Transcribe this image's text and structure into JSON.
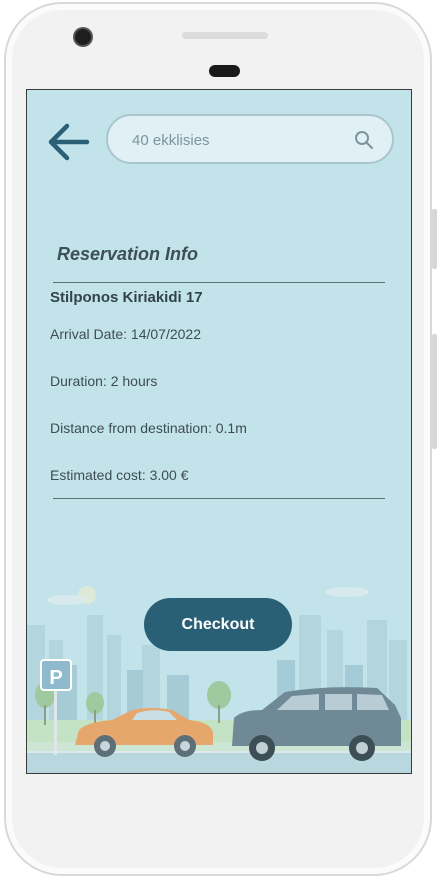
{
  "search": {
    "placeholder": "40 ekklisies",
    "value": ""
  },
  "reservation": {
    "heading": "Reservation Info",
    "address": "Stilponos Kiriakidi 17",
    "arrival": "Arrival Date: 14/07/2022",
    "duration": "Duration: 2 hours",
    "distance": "Distance from destination: 0.1m",
    "cost": "Estimated cost: 3.00 €"
  },
  "checkout_label": "Checkout",
  "parking_sign": "P",
  "icons": {
    "back": "arrow-left-icon",
    "search": "search-icon",
    "parking": "parking-sign-icon"
  },
  "colors": {
    "screen_bg": "#c3e3ea",
    "accent": "#2a6075",
    "text": "#3e4d53"
  }
}
